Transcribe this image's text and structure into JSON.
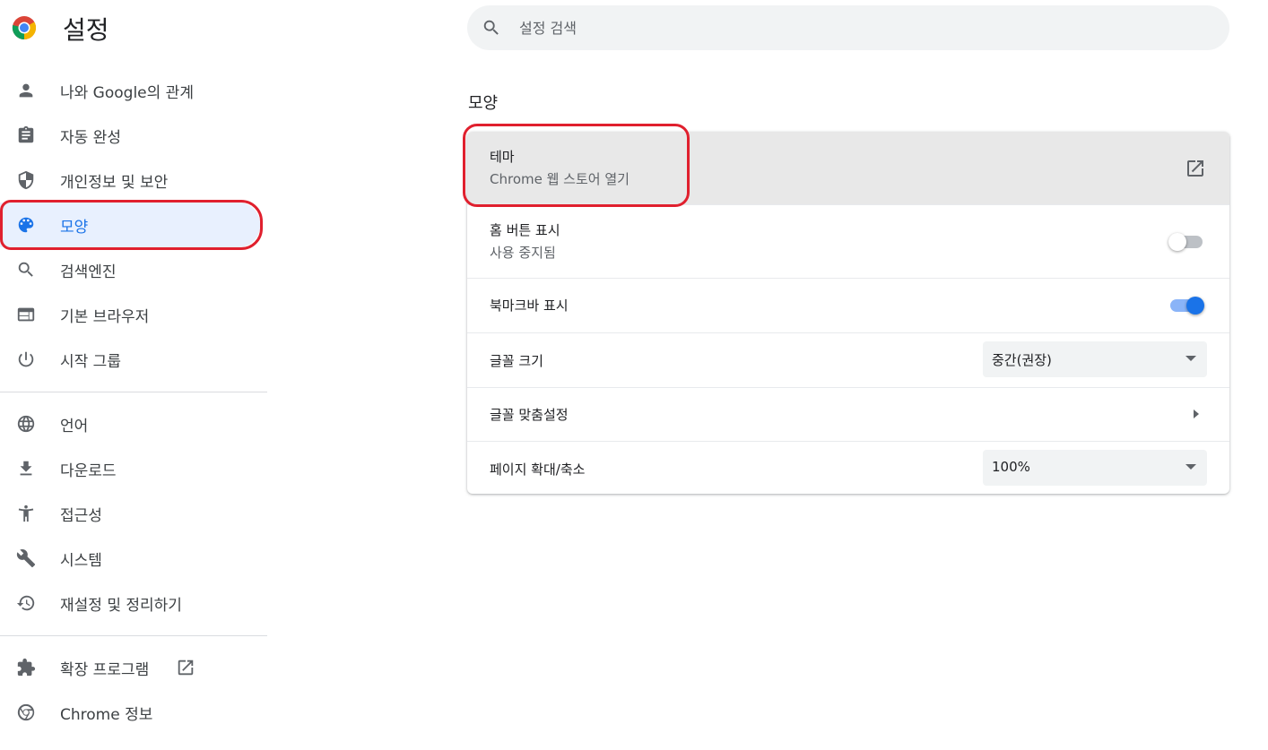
{
  "app": {
    "title": "설정"
  },
  "search": {
    "placeholder": "설정 검색"
  },
  "sidebar": {
    "items": [
      {
        "label": "나와 Google의 관계",
        "icon": "person-icon"
      },
      {
        "label": "자동 완성",
        "icon": "clipboard-icon"
      },
      {
        "label": "개인정보 및 보안",
        "icon": "shield-icon"
      },
      {
        "label": "모양",
        "icon": "palette-icon",
        "active": true
      },
      {
        "label": "검색엔진",
        "icon": "search-icon"
      },
      {
        "label": "기본 브라우저",
        "icon": "browser-window-icon"
      },
      {
        "label": "시작 그룹",
        "icon": "power-icon"
      }
    ],
    "advanced": [
      {
        "label": "언어",
        "icon": "globe-icon"
      },
      {
        "label": "다운로드",
        "icon": "download-icon"
      },
      {
        "label": "접근성",
        "icon": "accessibility-icon"
      },
      {
        "label": "시스템",
        "icon": "wrench-icon"
      },
      {
        "label": "재설정 및 정리하기",
        "icon": "history-icon"
      }
    ],
    "footer": [
      {
        "label": "확장 프로그램",
        "icon": "puzzle-icon"
      },
      {
        "label": "Chrome 정보",
        "icon": "chrome-icon"
      }
    ]
  },
  "appearance": {
    "section_title": "모양",
    "theme": {
      "title": "테마",
      "subtitle": "Chrome 웹 스토어 열기"
    },
    "home_button": {
      "title": "홈 버튼 표시",
      "subtitle": "사용 중지됨",
      "enabled": false
    },
    "bookmarks_bar": {
      "title": "북마크바 표시",
      "enabled": true
    },
    "font_size": {
      "title": "글꼴 크기",
      "value": "중간(권장)"
    },
    "customize_fonts": {
      "title": "글꼴 맞춤설정"
    },
    "page_zoom": {
      "title": "페이지 확대/축소",
      "value": "100%"
    }
  },
  "colors": {
    "accent": "#1a73e8",
    "highlight_box": "#e0202e",
    "active_nav_bg": "#e8f0fe"
  }
}
